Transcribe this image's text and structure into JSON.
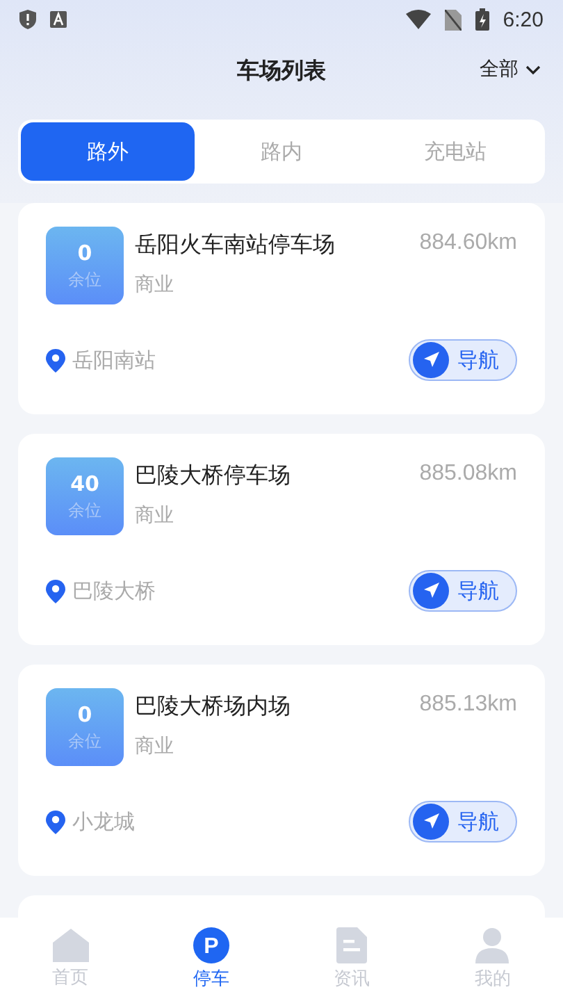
{
  "status_bar": {
    "time": "6:20"
  },
  "header": {
    "title": "车场列表",
    "filter": "全部"
  },
  "tabs": [
    {
      "label": "路外",
      "selected": true
    },
    {
      "label": "路内",
      "selected": false
    },
    {
      "label": "充电站",
      "selected": false
    }
  ],
  "lots": [
    {
      "spaces": "0",
      "spaces_label": "余位",
      "name": "岳阳火车南站停车场",
      "distance": "884.60km",
      "type": "商业",
      "location": "岳阳南站",
      "nav": "导航"
    },
    {
      "spaces": "40",
      "spaces_label": "余位",
      "name": "巴陵大桥停车场",
      "distance": "885.08km",
      "type": "商业",
      "location": "巴陵大桥",
      "nav": "导航"
    },
    {
      "spaces": "0",
      "spaces_label": "余位",
      "name": "巴陵大桥场内场",
      "distance": "885.13km",
      "type": "商业",
      "location": "小龙城",
      "nav": "导航"
    }
  ],
  "bottom_nav": [
    {
      "kind": "home",
      "label": "首页",
      "selected": false
    },
    {
      "kind": "parking",
      "label": "停车",
      "icon_letter": "P",
      "selected": true
    },
    {
      "kind": "news",
      "label": "资讯",
      "selected": false
    },
    {
      "kind": "profile",
      "label": "我的",
      "selected": false
    }
  ]
}
